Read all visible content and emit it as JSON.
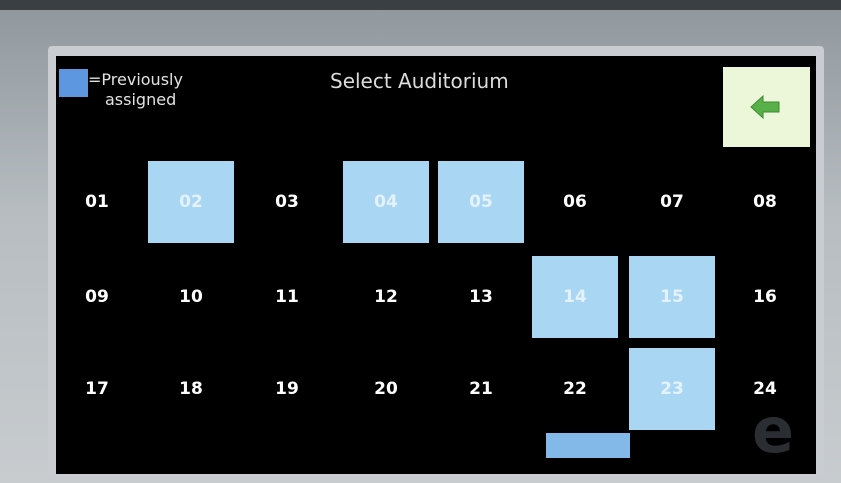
{
  "legend": {
    "swatch_color": "#5c97e0",
    "line1": "=Previously",
    "line2": "assigned"
  },
  "header": {
    "title": "Select Auditorium",
    "back_icon": "back-arrow-icon"
  },
  "colors": {
    "screen_background": "#000000",
    "assigned_tile": "#a9d6f2",
    "back_button": "#ecf7d9",
    "back_arrow": "#58b048"
  },
  "auditoriums": [
    {
      "label": "01",
      "assigned": false
    },
    {
      "label": "02",
      "assigned": true
    },
    {
      "label": "03",
      "assigned": false
    },
    {
      "label": "04",
      "assigned": true
    },
    {
      "label": "05",
      "assigned": true
    },
    {
      "label": "06",
      "assigned": false
    },
    {
      "label": "07",
      "assigned": false
    },
    {
      "label": "08",
      "assigned": false
    },
    {
      "label": "09",
      "assigned": false
    },
    {
      "label": "10",
      "assigned": false
    },
    {
      "label": "11",
      "assigned": false
    },
    {
      "label": "12",
      "assigned": false
    },
    {
      "label": "13",
      "assigned": false
    },
    {
      "label": "14",
      "assigned": true
    },
    {
      "label": "15",
      "assigned": true
    },
    {
      "label": "16",
      "assigned": false
    },
    {
      "label": "17",
      "assigned": false
    },
    {
      "label": "18",
      "assigned": false
    },
    {
      "label": "19",
      "assigned": false
    },
    {
      "label": "20",
      "assigned": false
    },
    {
      "label": "21",
      "assigned": false
    },
    {
      "label": "22",
      "assigned": false
    },
    {
      "label": "23",
      "assigned": true
    },
    {
      "label": "24",
      "assigned": false
    }
  ]
}
